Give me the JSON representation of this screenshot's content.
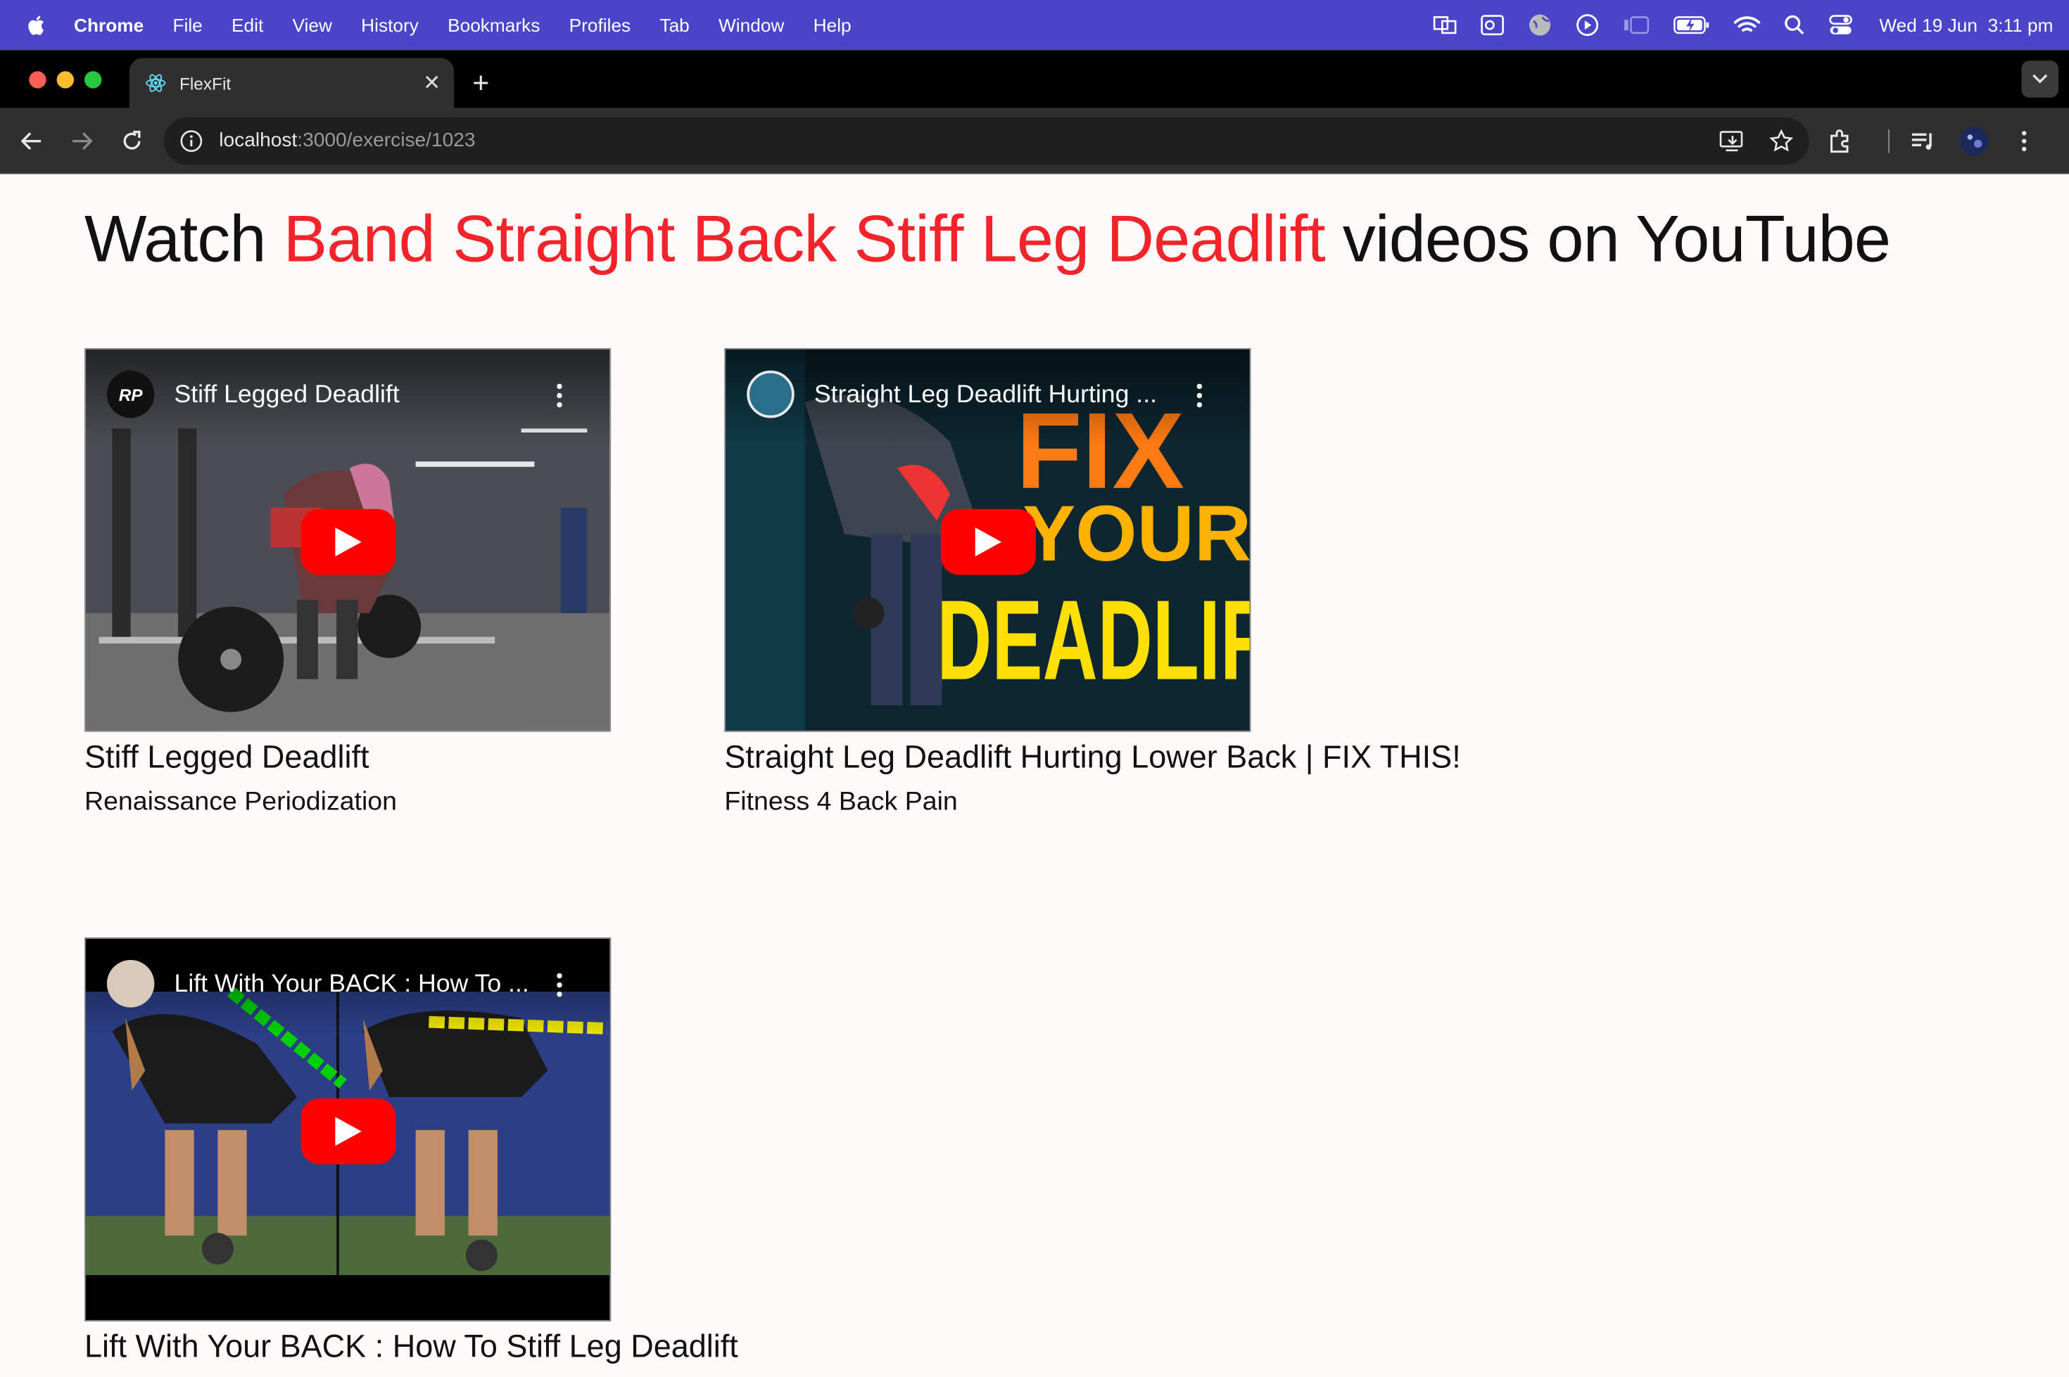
{
  "menubar": {
    "app": "Chrome",
    "items": [
      "File",
      "Edit",
      "View",
      "History",
      "Bookmarks",
      "Profiles",
      "Tab",
      "Window",
      "Help"
    ],
    "date": "Wed 19 Jun",
    "time": "3:11 pm"
  },
  "browser": {
    "tab_title": "FlexFit",
    "url_host": "localhost",
    "url_path": ":3000/exercise/1023"
  },
  "page": {
    "heading_prefix": "Watch",
    "exercise_name": "Band Straight Back Stiff Leg Deadlift",
    "heading_suffix": "videos on YouTube"
  },
  "videos": [
    {
      "title": "Stiff Legged Deadlift",
      "overlay_title": "Stiff Legged Deadlift",
      "channel": "Renaissance Periodization",
      "channel_badge": "RP"
    },
    {
      "title": "Straight Leg Deadlift Hurting Lower Back | FIX THIS!",
      "overlay_title": "Straight Leg Deadlift Hurting ...",
      "channel": "Fitness 4 Back Pain",
      "thumb_text_1": "FIX",
      "thumb_text_2": "YOUR",
      "thumb_text_3": "DEADLIF"
    },
    {
      "title": "Lift With Your BACK : How To Stiff Leg Deadlift",
      "overlay_title": "Lift With Your BACK : How To ...",
      "channel": ""
    }
  ],
  "colors": {
    "menubar": "#4a44c9",
    "highlight": "#f0242a",
    "youtube_red": "#ff0000"
  }
}
